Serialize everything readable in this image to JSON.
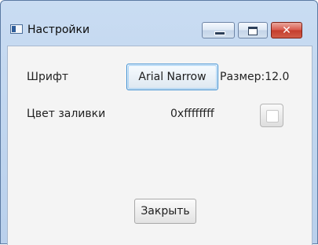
{
  "window": {
    "title": "Настройки",
    "controls": {
      "minimize": "minimize",
      "maximize": "maximize",
      "close": "✕"
    }
  },
  "form": {
    "font_label": "Шрифт",
    "font_button": "Arial Narrow",
    "size_label": "Размер:12.0",
    "fill_label": "Цвет заливки",
    "fill_value": "0xffffffff"
  },
  "footer": {
    "close_button": "Закрыть"
  },
  "icons": {
    "app": "app-window-icon",
    "minimize": "minimize-icon",
    "maximize": "maximize-icon",
    "close": "close-icon"
  },
  "colors": {
    "fill_color": "#ffffff",
    "focus_border": "#3c8fd3",
    "close_control": "#c43d2d"
  }
}
